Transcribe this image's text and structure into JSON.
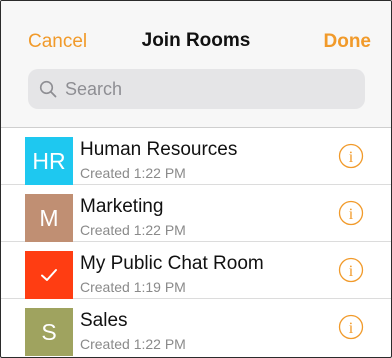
{
  "nav": {
    "cancel_label": "Cancel",
    "title": "Join Rooms",
    "done_label": "Done"
  },
  "search": {
    "placeholder": "Search",
    "value": ""
  },
  "rooms": [
    {
      "initials": "HR",
      "name": "Human Resources",
      "created": "Created 1:22 PM",
      "color": "#1ec8f0",
      "selected": false,
      "icon": "info-icon"
    },
    {
      "initials": "M",
      "name": "Marketing",
      "created": "Created 1:22 PM",
      "color": "#c08f73",
      "selected": false,
      "icon": "info-icon"
    },
    {
      "initials": "",
      "name": "My Public Chat Room",
      "created": "Created 1:19 PM",
      "color": "#ff3d12",
      "selected": true,
      "icon": "checkmark-icon"
    },
    {
      "initials": "S",
      "name": "Sales",
      "created": "Created 1:22 PM",
      "color": "#9fa35f",
      "selected": false,
      "icon": "info-icon"
    }
  ],
  "colors": {
    "accent": "#f19a2a",
    "header_bg": "#f7f7f7",
    "search_bg": "#e5e5e7"
  }
}
